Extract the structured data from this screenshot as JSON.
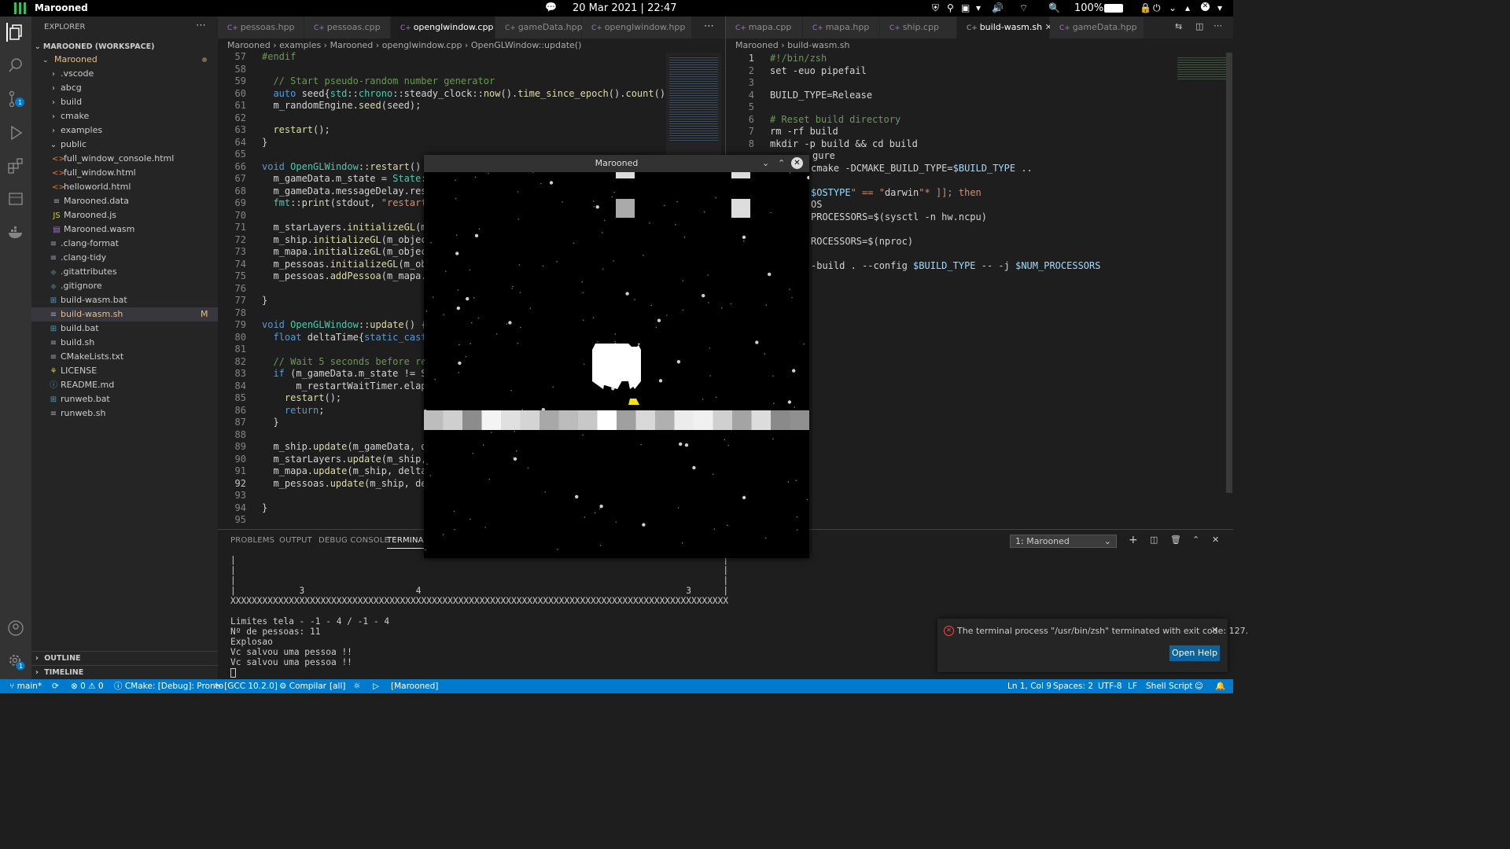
{
  "topbar": {
    "date_time": "20 Mar 2021 | 22:47",
    "app_title": "Marooned",
    "battery": "100%"
  },
  "explorer": {
    "header": "EXPLORER",
    "workspace": "MAROONED (WORKSPACE)",
    "root": "Marooned",
    "items": [
      {
        "label": ".vscode",
        "type": "folder",
        "depth": 1
      },
      {
        "label": "abcg",
        "type": "folder",
        "depth": 1
      },
      {
        "label": "build",
        "type": "folder",
        "depth": 1
      },
      {
        "label": "cmake",
        "type": "folder",
        "depth": 1
      },
      {
        "label": "examples",
        "type": "folder",
        "depth": 1
      },
      {
        "label": "public",
        "type": "folder-open",
        "depth": 1
      },
      {
        "label": "full_window_console.html",
        "type": "html",
        "depth": 2
      },
      {
        "label": "full_window.html",
        "type": "html",
        "depth": 2
      },
      {
        "label": "helloworld.html",
        "type": "html",
        "depth": 2
      },
      {
        "label": "Marooned.data",
        "type": "file",
        "depth": 2
      },
      {
        "label": "Marooned.js",
        "type": "js",
        "depth": 2
      },
      {
        "label": "Marooned.wasm",
        "type": "wasm",
        "depth": 2
      },
      {
        "label": ".clang-format",
        "type": "file",
        "depth": 1
      },
      {
        "label": ".clang-tidy",
        "type": "file",
        "depth": 1
      },
      {
        "label": ".gitattributes",
        "type": "git",
        "depth": 1
      },
      {
        "label": ".gitignore",
        "type": "git",
        "depth": 1
      },
      {
        "label": "build-wasm.bat",
        "type": "win",
        "depth": 1
      },
      {
        "label": "build-wasm.sh",
        "type": "file",
        "depth": 1,
        "badge": "M",
        "selected": true
      },
      {
        "label": "build.bat",
        "type": "win",
        "depth": 1
      },
      {
        "label": "build.sh",
        "type": "file",
        "depth": 1
      },
      {
        "label": "CMakeLists.txt",
        "type": "cmake",
        "depth": 1
      },
      {
        "label": "LICENSE",
        "type": "license",
        "depth": 1
      },
      {
        "label": "README.md",
        "type": "info",
        "depth": 1
      },
      {
        "label": "runweb.bat",
        "type": "win",
        "depth": 1
      },
      {
        "label": "runweb.sh",
        "type": "file",
        "depth": 1
      }
    ],
    "outline": "OUTLINE",
    "timeline": "TIMELINE"
  },
  "editor1": {
    "tabs": [
      "pessoas.hpp",
      "pessoas.cpp",
      "openglwindow.cpp",
      "gameData.hpp",
      "openglwindow.hpp"
    ],
    "active_tab": 2,
    "breadcrumb": [
      "Marooned",
      "examples",
      "Marooned",
      "openglwindow.cpp",
      "OpenGLWindow::update()"
    ],
    "lines": [
      {
        "n": "57",
        "t": "#endif"
      },
      {
        "n": "58",
        "t": ""
      },
      {
        "n": "59",
        "t": "  // Start pseudo-random number generator"
      },
      {
        "n": "60",
        "t": "  auto seed{std::chrono::steady_clock::now().time_since_epoch().count()};"
      },
      {
        "n": "61",
        "t": "  m_randomEngine.seed(seed);"
      },
      {
        "n": "62",
        "t": ""
      },
      {
        "n": "63",
        "t": "  restart();"
      },
      {
        "n": "64",
        "t": "}"
      },
      {
        "n": "65",
        "t": ""
      },
      {
        "n": "66",
        "t": "void OpenGLWindow::restart() {"
      },
      {
        "n": "67",
        "t": "  m_gameData.m_state = State::"
      },
      {
        "n": "68",
        "t": "  m_gameData.messageDelay.rest"
      },
      {
        "n": "69",
        "t": "  fmt::print(stdout, \"restart\\"
      },
      {
        "n": "70",
        "t": ""
      },
      {
        "n": "71",
        "t": "  m_starLayers.initializeGL(m_"
      },
      {
        "n": "72",
        "t": "  m_ship.initializeGL(m_object"
      },
      {
        "n": "73",
        "t": "  m_mapa.initializeGL(m_object"
      },
      {
        "n": "74",
        "t": "  m_pessoas.initializeGL(m_obj"
      },
      {
        "n": "75",
        "t": "  m_pessoas.addPessoa(m_mapa.n"
      },
      {
        "n": "76",
        "t": ""
      },
      {
        "n": "77",
        "t": "}"
      },
      {
        "n": "78",
        "t": ""
      },
      {
        "n": "79",
        "t": "void OpenGLWindow::update() {"
      },
      {
        "n": "80",
        "t": "  float deltaTime{static_cast<"
      },
      {
        "n": "81",
        "t": ""
      },
      {
        "n": "82",
        "t": "  // Wait 5 seconds before res"
      },
      {
        "n": "83",
        "t": "  if (m_gameData.m_state != St"
      },
      {
        "n": "84",
        "t": "      m_restartWaitTimer.elaps"
      },
      {
        "n": "85",
        "t": "    restart();"
      },
      {
        "n": "86",
        "t": "    return;"
      },
      {
        "n": "87",
        "t": "  }"
      },
      {
        "n": "88",
        "t": ""
      },
      {
        "n": "89",
        "t": "  m_ship.update(m_gameData, de"
      },
      {
        "n": "90",
        "t": "  m_starLayers.update(m_ship,"
      },
      {
        "n": "91",
        "t": "  m_mapa.update(m_ship, deltaT"
      },
      {
        "n": "92",
        "t": "  m_pessoas.update(m_ship, del"
      },
      {
        "n": "93",
        "t": ""
      },
      {
        "n": "94",
        "t": "}"
      },
      {
        "n": "95",
        "t": ""
      }
    ]
  },
  "editor2": {
    "tabs": [
      "mapa.cpp",
      "mapa.hpp",
      "ship.cpp",
      "build-wasm.sh",
      "gameData.hpp"
    ],
    "active_tab": 3,
    "breadcrumb": [
      "Marooned",
      "build-wasm.sh"
    ],
    "lines": [
      {
        "n": "1",
        "t": "#!/bin/zsh"
      },
      {
        "n": "2",
        "t": "set -euo pipefail"
      },
      {
        "n": "3",
        "t": ""
      },
      {
        "n": "4",
        "t": "BUILD_TYPE=Release"
      },
      {
        "n": "5",
        "t": ""
      },
      {
        "n": "6",
        "t": "# Reset build directory"
      },
      {
        "n": "7",
        "t": "rm -rf build"
      },
      {
        "n": "8",
        "t": "mkdir -p build && cd build"
      }
    ],
    "hidden_lines": [
      {
        "t": "gure"
      },
      {
        "t": "cmake -DCMAKE_BUILD_TYPE=$BUILD_TYPE .."
      },
      {
        "t": ""
      },
      {
        "t": "$OSTYPE\" == \"darwin\"* ]]; then"
      },
      {
        "t": "OS"
      },
      {
        "t": "PROCESSORS=$(sysctl -n hw.ncpu)"
      },
      {
        "t": ""
      },
      {
        "t": "ROCESSORS=$(nproc)"
      },
      {
        "t": ""
      },
      {
        "t": "-build . --config $BUILD_TYPE -- -j $NUM_PROCESSORS"
      }
    ]
  },
  "game_window": {
    "title": "Marooned"
  },
  "panel": {
    "tabs": [
      "PROBLEMS",
      "OUTPUT",
      "DEBUG CONSOLE",
      "TERMINAL"
    ],
    "active_tab": 3,
    "terminal_select": "1: Marooned",
    "terminal_lines": [
      "|                                                                                            |",
      "|                                                                                            |",
      "|                                                                                            |",
      "|            3                     4                                                  3      |",
      "XXXXXXXXXXXXXXXXXXXXXXXXXXXXXXXXXXXXXXXXXXXXXXXXXXXXXXXXXXXXXXXXXXXXXXXXXXXXXXXXXXXXXXXXXXXXXX",
      "",
      "Limites tela - -1 - 4 / -1 - 4",
      "Nº de pessoas: 11",
      "Explosao",
      "Vc salvou uma pessoa !!",
      "Vc salvou uma pessoa !!"
    ]
  },
  "notification": {
    "message": "The terminal process \"/usr/bin/zsh\" terminated with exit code: 127.",
    "button": "Open Help"
  },
  "statusbar": {
    "branch": "main*",
    "errors": "0",
    "warnings": "0",
    "cmake": "CMake: [Debug]: Pronto",
    "compiler": "[GCC 10.2.0]",
    "compile": "Compilar",
    "target": "[all]",
    "launch": "[Marooned]",
    "position": "Ln 1, Col 9",
    "spaces": "Spaces: 2",
    "encoding": "UTF-8",
    "eol": "LF",
    "language": "Shell Script"
  },
  "colors": {
    "statusbar": "#007acc",
    "activity": "#333333",
    "sidebar": "#252526",
    "editor": "#1e1e1e",
    "accent": "#35bf5c"
  }
}
